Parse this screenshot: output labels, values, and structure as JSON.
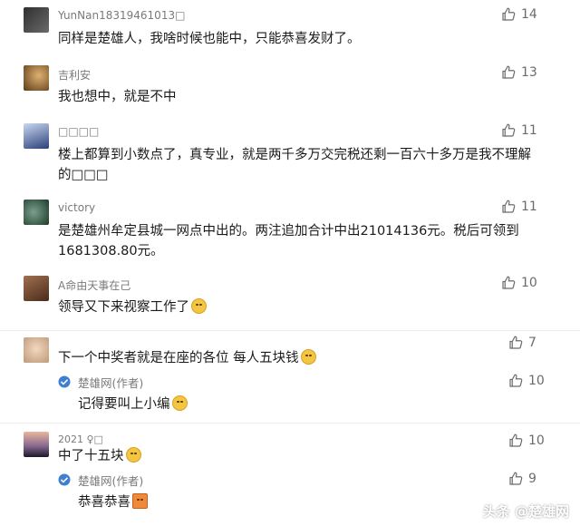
{
  "comments": [
    {
      "name": "YunNan18319461013□",
      "text": "同样是楚雄人，我啥时候也能中，只能恭喜发财了。",
      "likes": "14",
      "avatar_color": "#4a4a4a"
    },
    {
      "name": "吉利安",
      "text": "我也想中，就是不中",
      "likes": "13",
      "avatar_color": "#8a6a3a"
    },
    {
      "name": "□□□□",
      "text": "楼上都算到小数点了，真专业，就是两千多万交完税还剩一百六十多万是我不理解的□□□",
      "likes": "11",
      "avatar_color": "#3f5fa8"
    },
    {
      "name": "victory",
      "text": "是楚雄州牟定县城一网点中出的。两注追加合计中出21014136元。税后可领到1681308.80元。",
      "likes": "11",
      "avatar_color": "#2f4a3c"
    },
    {
      "name": "A命由天事在己",
      "text": "领导又下来视察工作了",
      "likes": "10",
      "avatar_color": "#6a4a3a",
      "emoji": "sleepy-face-emoji"
    },
    {
      "name": "",
      "text": "下一个中奖者就是在座的各位 每人五块钱",
      "likes": "7",
      "avatar_color": "#d9c3a8",
      "emoji": "thinking-face-emoji",
      "reply": {
        "name": "楚雄网(作者)",
        "text": "记得要叫上小编",
        "likes": "10",
        "emoji": "thinking-face-emoji"
      }
    },
    {
      "name": "2021 ♀□",
      "text": "中了十五块",
      "likes": "10",
      "avatar_color": "#2a2a3a",
      "emoji": "laughing-face-emoji",
      "reply": {
        "name": "楚雄网(作者)",
        "text": "恭喜恭喜",
        "likes": "9",
        "emoji": "party-popper-emoji"
      }
    }
  ],
  "watermark": "头条 @楚雄网",
  "colors": {
    "accent_blue": "#3f7fd1",
    "text": "#1a1a1a",
    "meta": "#7a7a7a"
  }
}
